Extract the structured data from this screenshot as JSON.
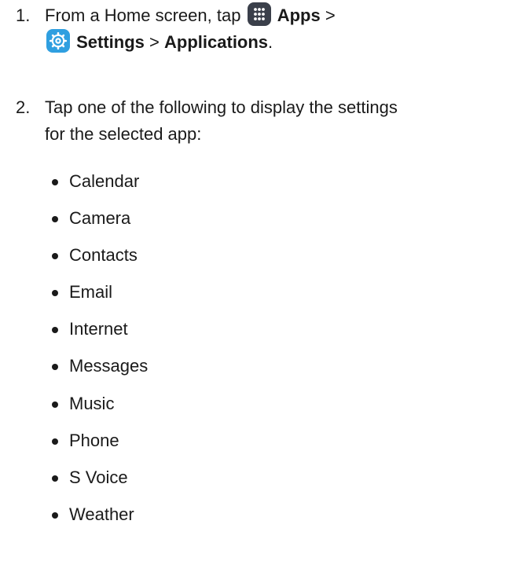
{
  "steps": [
    {
      "number": "1.",
      "line1_prefix": "From a Home screen, tap",
      "apps_icon": "apps-grid-icon",
      "apps_label": "Apps",
      "sep1": ">",
      "settings_icon": "settings-gear-icon",
      "settings_label": "Settings",
      "sep2": ">",
      "applications_label": "Applications",
      "end": "."
    },
    {
      "number": "2.",
      "text_line1": "Tap one of the following to display the settings",
      "text_line2": "for the selected app:"
    }
  ],
  "apps": [
    "Calendar",
    "Camera",
    "Contacts",
    "Email",
    "Internet",
    "Messages",
    "Music",
    "Phone",
    "S Voice",
    "Weather"
  ],
  "colors": {
    "text": "#1a1a1a",
    "apps_icon_bg": "#3a3f4a",
    "settings_icon_bg": "#2f9fe0"
  }
}
